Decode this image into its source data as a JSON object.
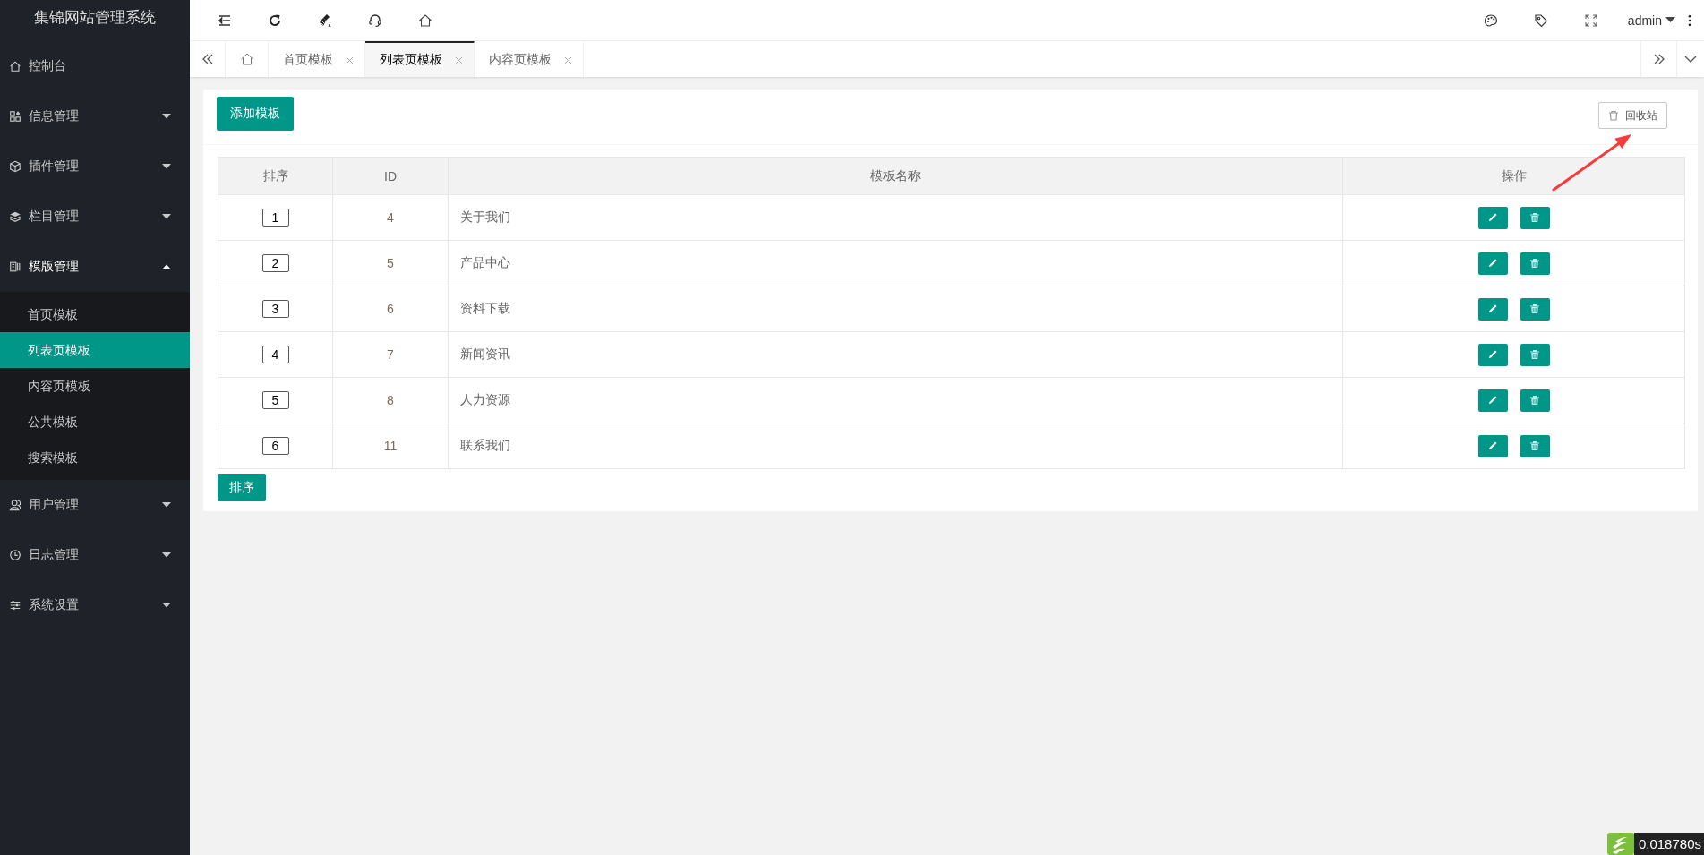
{
  "sidebar": {
    "title": "集锦网站管理系统",
    "items": [
      {
        "label": "控制台"
      },
      {
        "label": "信息管理",
        "expanded": false
      },
      {
        "label": "插件管理",
        "expanded": false
      },
      {
        "label": "栏目管理",
        "expanded": false
      },
      {
        "label": "模版管理",
        "expanded": true,
        "children": [
          {
            "label": "首页模板",
            "selected": false
          },
          {
            "label": "列表页模板",
            "selected": true
          },
          {
            "label": "内容页模板",
            "selected": false
          },
          {
            "label": "公共模板",
            "selected": false
          },
          {
            "label": "搜索模板",
            "selected": false
          }
        ]
      },
      {
        "label": "用户管理",
        "expanded": false
      },
      {
        "label": "日志管理",
        "expanded": false
      },
      {
        "label": "系统设置",
        "expanded": false
      }
    ]
  },
  "header": {
    "user": "admin"
  },
  "tabs": [
    {
      "label": "首页模板",
      "selected": false
    },
    {
      "label": "列表页模板",
      "selected": true
    },
    {
      "label": "内容页模板",
      "selected": false
    }
  ],
  "panel": {
    "add_button": "添加模板",
    "recycle_button": "回收站",
    "sort_button": "排序"
  },
  "table": {
    "columns": [
      "排序",
      "ID",
      "模板名称",
      "操作"
    ],
    "rows": [
      {
        "sort": "1",
        "id": "4",
        "name": "关于我们"
      },
      {
        "sort": "2",
        "id": "5",
        "name": "产品中心"
      },
      {
        "sort": "3",
        "id": "6",
        "name": "资料下载"
      },
      {
        "sort": "4",
        "id": "7",
        "name": "新闻资讯"
      },
      {
        "sort": "5",
        "id": "8",
        "name": "人力资源"
      },
      {
        "sort": "6",
        "id": "11",
        "name": "联系我们"
      }
    ]
  },
  "timer": "0.018780s"
}
